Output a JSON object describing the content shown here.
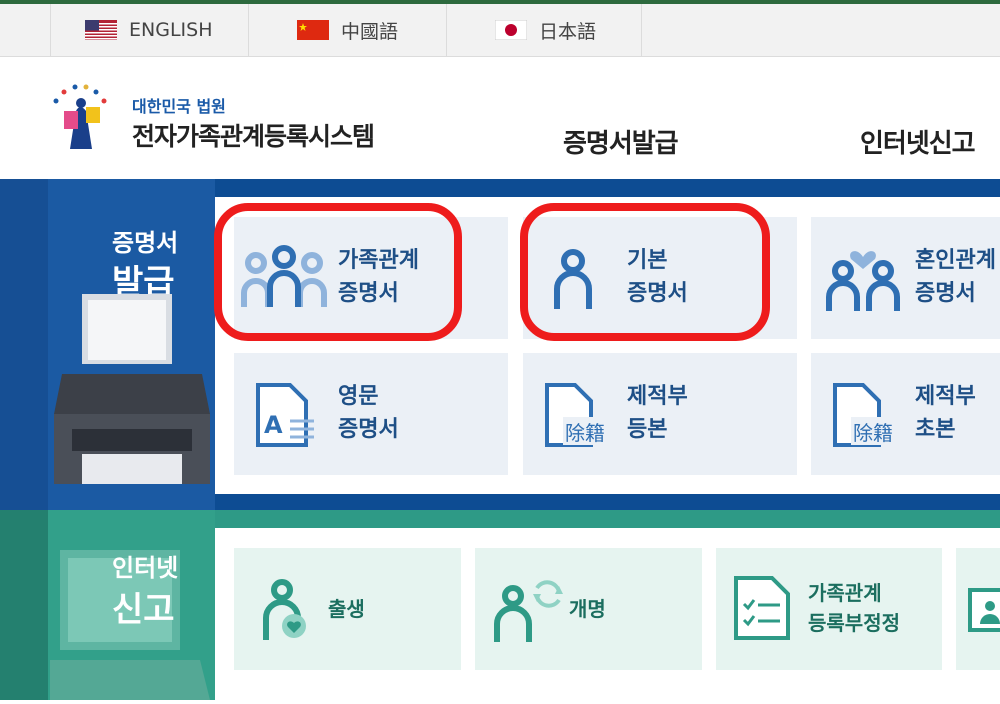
{
  "languages": [
    {
      "label": "ENGLISH",
      "flag": "us-flag-icon"
    },
    {
      "label": "中國語",
      "flag": "china-flag-icon"
    },
    {
      "label": "日本語",
      "flag": "japan-flag-icon"
    }
  ],
  "header": {
    "org": "대한민국 법원",
    "system": "전자가족관계등록시스템",
    "nav": [
      "증명서발급",
      "인터넷신고"
    ]
  },
  "section1": {
    "title_line1": "증명서",
    "title_line2": "발급",
    "cards": [
      {
        "line1": "가족관계",
        "line2": "증명서",
        "icon": "family-icon"
      },
      {
        "line1": "기본",
        "line2": "증명서",
        "icon": "person-icon"
      },
      {
        "line1": "혼인관계",
        "line2": "증명서",
        "icon": "couple-heart-icon"
      },
      {
        "line1": "영문",
        "line2": "증명서",
        "icon": "english-document-icon"
      },
      {
        "line1": "제적부",
        "line2": "등본",
        "icon": "removed-register-document-icon",
        "stamp": "除籍"
      },
      {
        "line1": "제적부",
        "line2": "초본",
        "icon": "removed-register-document-icon",
        "stamp": "除籍"
      }
    ]
  },
  "section2": {
    "title_line1": "인터넷",
    "title_line2": "신고",
    "cards": [
      {
        "line1": "출생",
        "line2": "",
        "icon": "birth-icon"
      },
      {
        "line1": "개명",
        "line2": "",
        "icon": "rename-icon"
      },
      {
        "line1": "가족관계",
        "line2": "등록부정정",
        "icon": "checklist-document-icon"
      }
    ]
  },
  "colors": {
    "highlight": "#ee1c1c",
    "blue": "#0d4c93",
    "green": "#2e9a86"
  }
}
